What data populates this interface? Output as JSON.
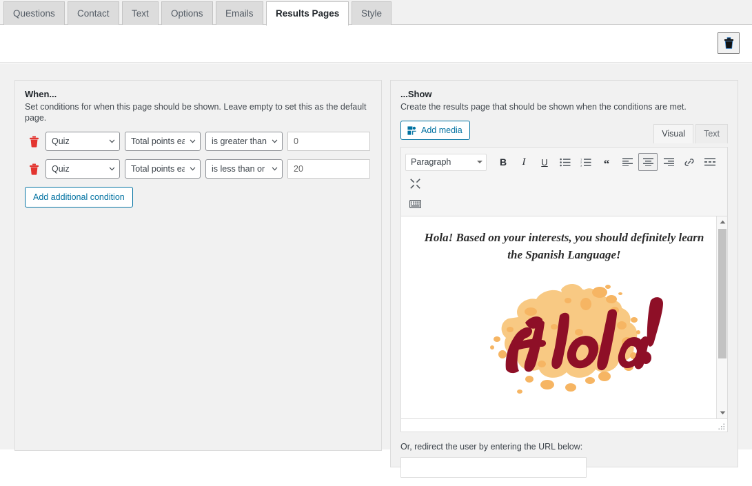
{
  "tabs": [
    {
      "label": "Questions",
      "active": false
    },
    {
      "label": "Contact",
      "active": false
    },
    {
      "label": "Text",
      "active": false
    },
    {
      "label": "Options",
      "active": false
    },
    {
      "label": "Emails",
      "active": false
    },
    {
      "label": "Results Pages",
      "active": true
    },
    {
      "label": "Style",
      "active": false
    }
  ],
  "toolbar": {
    "delete_icon": "trash-icon"
  },
  "when_panel": {
    "title": "When...",
    "description": "Set conditions for when this page should be shown. Leave empty to set this as the default page.",
    "add_condition_label": "Add additional condition",
    "conditions": [
      {
        "delete_icon": "trash-icon",
        "subject": "Quiz",
        "field": "Total points earned",
        "operator": "is greater than or equal to",
        "value": "0"
      },
      {
        "delete_icon": "trash-icon",
        "subject": "Quiz",
        "field": "Total points earned",
        "operator": "is less than or equal to",
        "value": "20"
      }
    ]
  },
  "show_panel": {
    "title": "...Show",
    "description": "Create the results page that should be shown when the conditions are met.",
    "add_media_label": "Add media",
    "add_media_icon": "media-icon",
    "editor_tabs": [
      {
        "label": "Visual",
        "active": true
      },
      {
        "label": "Text",
        "active": false
      }
    ],
    "format_select": "Paragraph",
    "toolbar_row1": [
      {
        "name": "bold-icon",
        "glyph": "B",
        "pressed": false
      },
      {
        "name": "italic-icon",
        "glyph": "I",
        "pressed": false
      },
      {
        "name": "underline-icon",
        "glyph": "U",
        "pressed": false
      },
      {
        "name": "bulleted-list-icon",
        "glyph": "",
        "pressed": false
      },
      {
        "name": "numbered-list-icon",
        "glyph": "",
        "pressed": false
      },
      {
        "name": "blockquote-icon",
        "glyph": "",
        "pressed": false
      },
      {
        "name": "align-left-icon",
        "glyph": "",
        "pressed": false
      },
      {
        "name": "align-center-icon",
        "glyph": "",
        "pressed": true
      },
      {
        "name": "align-right-icon",
        "glyph": "",
        "pressed": false
      },
      {
        "name": "insert-link-icon",
        "glyph": "",
        "pressed": false
      },
      {
        "name": "read-more-icon",
        "glyph": "",
        "pressed": false
      },
      {
        "name": "fullscreen-icon",
        "glyph": "",
        "pressed": false
      }
    ],
    "toolbar_row2": [
      {
        "name": "toolbar-toggle-icon",
        "glyph": "",
        "pressed": false
      }
    ],
    "document": {
      "heading": "Hola! Based on your interests, you should definitely learn the Spanish Language!",
      "image_alt": "Hola!",
      "image_word": "Hola!"
    },
    "redirect_label": "Or, redirect the user by entering the URL below:",
    "redirect_value": "",
    "redirect_placeholder": ""
  },
  "colors": {
    "accent_blue": "#0071a1",
    "trash_red": "#e3342f",
    "splatter_orange": "#f8c983",
    "splatter_orange_dark": "#f6b563",
    "script_maroon": "#8e0f27",
    "page_bg": "#f1f1f1",
    "active_tab_bg": "#ffffff"
  }
}
